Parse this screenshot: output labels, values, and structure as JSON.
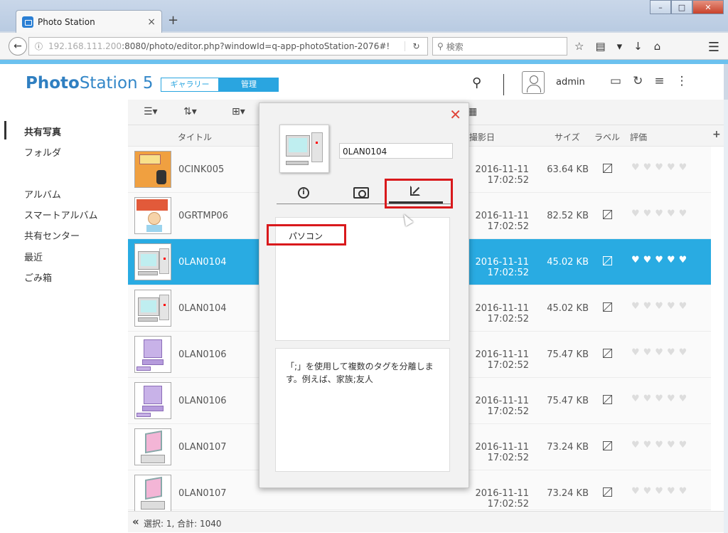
{
  "browser": {
    "tab_title": "Photo Station",
    "tab_close": "×",
    "new_tab": "+",
    "url_host": "192.168.111.200",
    "url_path": ":8080/photo/editor.php?windowId=q-app-photoStation-2076#!",
    "search_placeholder": "検索",
    "window_buttons": [
      "–",
      "□",
      "✕"
    ]
  },
  "app": {
    "logo_bold": "Photo",
    "logo_rest": "Station 5",
    "mode_gallery": "ギャラリー",
    "mode_manage": "管理",
    "username": "admin"
  },
  "sidebar": {
    "items": [
      {
        "label": "共有写真"
      },
      {
        "label": "フォルダ"
      },
      {
        "label": "アルバム"
      },
      {
        "label": "スマートアルバム"
      },
      {
        "label": "共有センター"
      },
      {
        "label": "最近"
      },
      {
        "label": "ごみ箱"
      }
    ]
  },
  "columns": {
    "title": "タイトル",
    "date": "撮影日",
    "size": "サイズ",
    "label": "ラベル",
    "rating": "評価",
    "add": "+"
  },
  "rows": [
    {
      "name": "0CINK005",
      "date": "2016-11-11 17:02:52",
      "size": "63.64 KB"
    },
    {
      "name": "0GRTMP06",
      "date": "2016-11-11 17:02:52",
      "size": "82.52 KB"
    },
    {
      "name": "0LAN0104",
      "date": "2016-11-11 17:02:52",
      "size": "45.02 KB"
    },
    {
      "name": "0LAN0104",
      "date": "2016-11-11 17:02:52",
      "size": "45.02 KB"
    },
    {
      "name": "0LAN0106",
      "date": "2016-11-11 17:02:52",
      "size": "75.47 KB"
    },
    {
      "name": "0LAN0106",
      "date": "2016-11-11 17:02:52",
      "size": "75.47 KB"
    },
    {
      "name": "0LAN0107",
      "date": "2016-11-11 17:02:52",
      "size": "73.24 KB"
    },
    {
      "name": "0LAN0107",
      "date": "2016-11-11 17:02:52",
      "size": "73.24 KB"
    }
  ],
  "status": {
    "collapse": "«",
    "text": "選択: 1, 合計: 1040"
  },
  "dialog": {
    "close": "✕",
    "name_value": "0LAN0104",
    "tag_value": "パソコン",
    "hint": "「;」を使用して複数のタグを分離します。例えば、家族;友人"
  },
  "colors": {
    "accent": "#29abe2",
    "highlight_red": "#d9191c"
  }
}
